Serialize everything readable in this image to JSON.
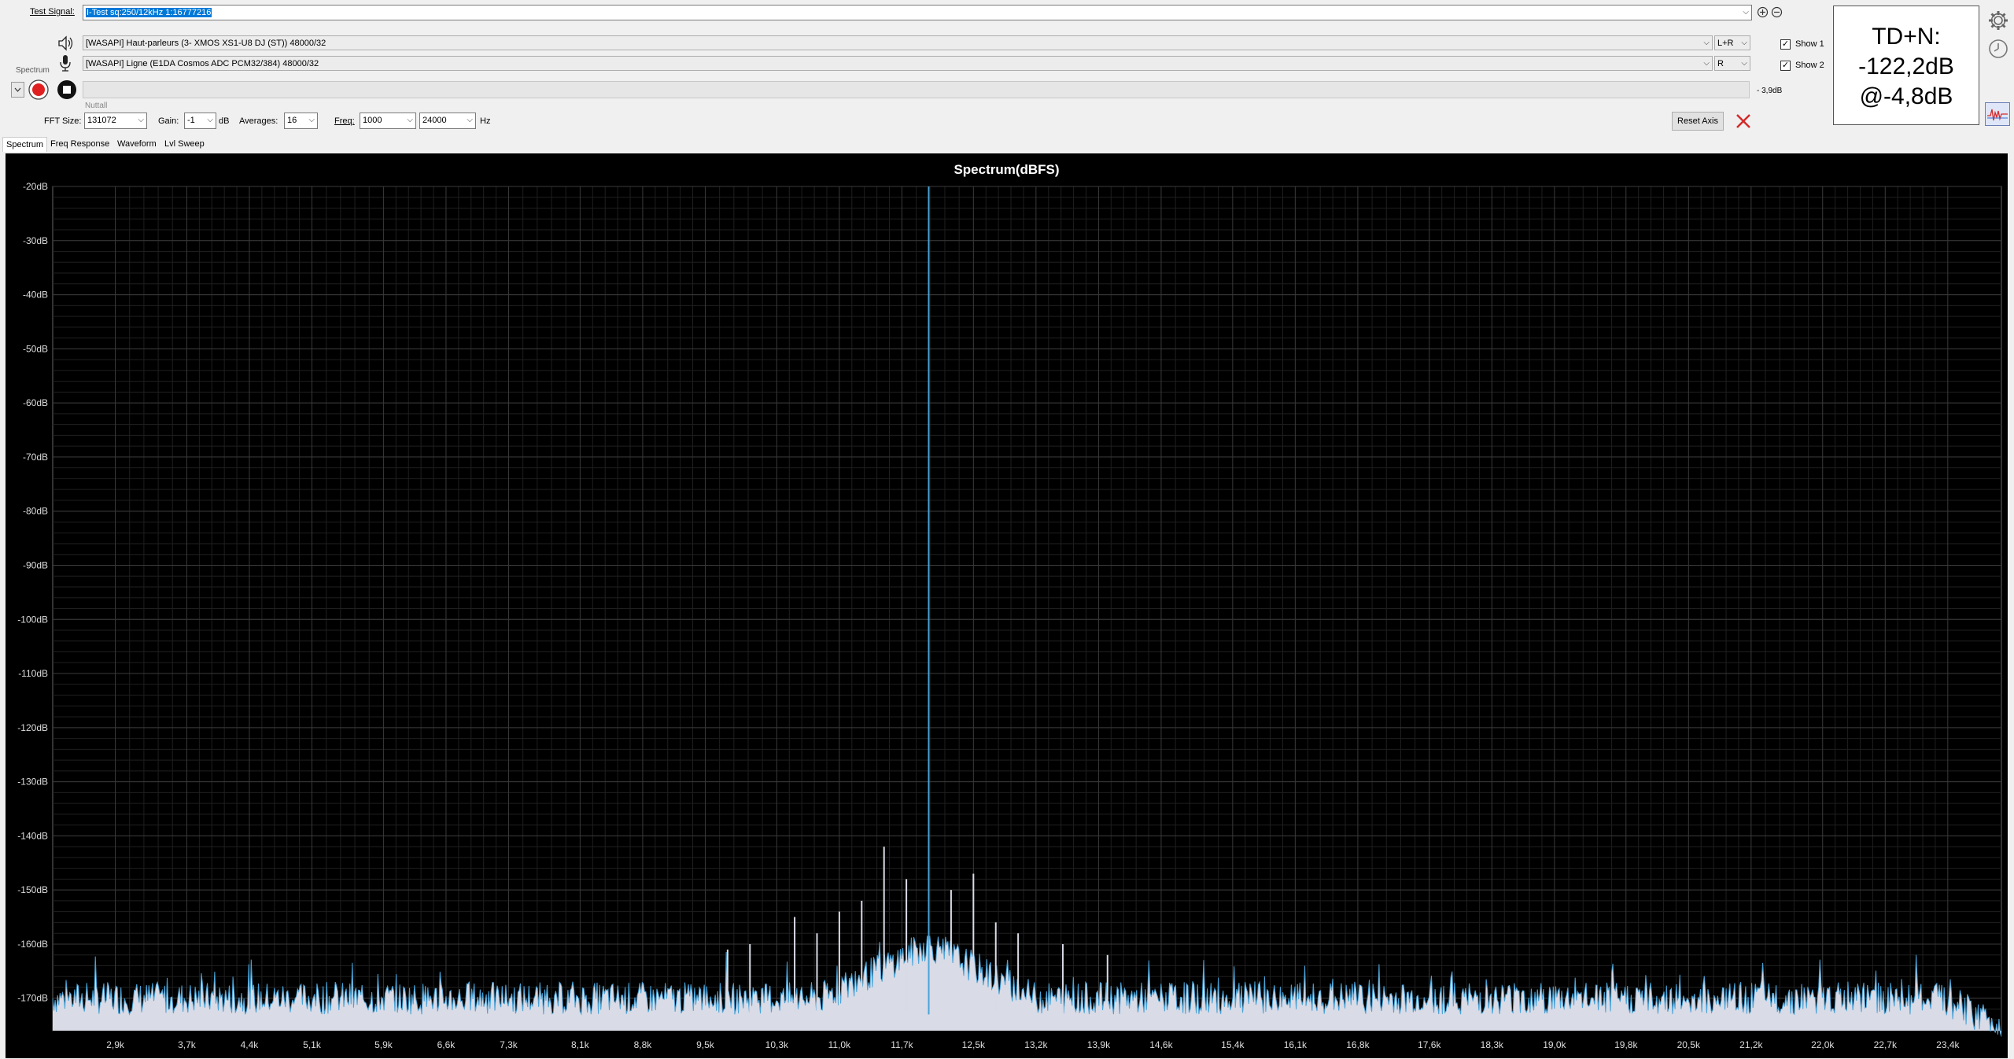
{
  "toolbar": {
    "test_signal_label": "Test Signal:",
    "test_signal_value": "I-Test sq:250/12kHz 1:16777216",
    "spectrum_label": "Spectrum",
    "output_device": "[WASAPI] Haut-parleurs (3- XMOS XS1-U8 DJ (ST)) 48000/32",
    "output_channel": "L+R",
    "input_device": "[WASAPI] Ligne (E1DA Cosmos ADC PCM32/384) 48000/32",
    "input_channel": "R",
    "level_readout": "- 3,9dB",
    "window_name": "Nuttall",
    "show1_label": "Show 1",
    "show2_label": "Show 2",
    "fft_size_label": "FFT Size:",
    "fft_size_value": "131072",
    "gain_label": "Gain:",
    "gain_value": "-1",
    "gain_unit": "dB",
    "averages_label": "Averages:",
    "averages_value": "16",
    "freq_label": "Freq:",
    "freq_value": "1000",
    "freq2_value": "24000",
    "freq_unit": "Hz",
    "reset_axis_label": "Reset Axis"
  },
  "tabs": [
    "Spectrum",
    "Freq Response",
    "Waveform",
    "Lvl Sweep"
  ],
  "readout": {
    "line1": "TD+N:",
    "line2": "-122,2dB",
    "line3": "@-4,8dB"
  },
  "colors": {
    "trace": "#4aa3d8",
    "fill": "#d9dbe6",
    "background": "#000000",
    "grid": "#3a3a3a",
    "close_red": "#d42a2a",
    "record_red": "#e02020"
  },
  "chart_data": {
    "type": "line",
    "title": "Spectrum(dBFS)",
    "ylim": [
      -176,
      -20
    ],
    "y_ticks": [
      "-20dB",
      "-30dB",
      "-40dB",
      "-50dB",
      "-60dB",
      "-70dB",
      "-80dB",
      "-90dB",
      "-100dB",
      "-110dB",
      "-120dB",
      "-130dB",
      "-140dB",
      "-150dB",
      "-160dB",
      "-170dB"
    ],
    "y_tick_values": [
      -20,
      -30,
      -40,
      -50,
      -60,
      -70,
      -80,
      -90,
      -100,
      -110,
      -120,
      -130,
      -140,
      -150,
      -160,
      -170
    ],
    "x_ticks": [
      "2,9k",
      "3,7k",
      "4,4k",
      "5,1k",
      "5,9k",
      "6,6k",
      "7,3k",
      "8,1k",
      "8,8k",
      "9,5k",
      "10,3k",
      "11,0k",
      "11,7k",
      "12,5k",
      "13,2k",
      "13,9k",
      "14,6k",
      "15,4k",
      "16,1k",
      "16,8k",
      "17,6k",
      "18,3k",
      "19,0k",
      "19,8k",
      "20,5k",
      "21,2k",
      "22,0k",
      "22,7k",
      "23,4k"
    ],
    "x_tick_values": [
      2900,
      3700,
      4400,
      5100,
      5900,
      6600,
      7300,
      8100,
      8800,
      9500,
      10300,
      11000,
      11700,
      12500,
      13200,
      13900,
      14600,
      15400,
      16100,
      16800,
      17600,
      18300,
      19000,
      19800,
      20500,
      21200,
      22000,
      22700,
      23400
    ],
    "xlim": [
      2200,
      24000
    ],
    "noise_floor": -170,
    "peaks": [
      {
        "freq": 12000,
        "level": -20
      },
      {
        "freq": 11750,
        "level": -148
      },
      {
        "freq": 12250,
        "level": -150
      },
      {
        "freq": 11500,
        "level": -142
      },
      {
        "freq": 12500,
        "level": -147
      },
      {
        "freq": 11250,
        "level": -152
      },
      {
        "freq": 12750,
        "level": -156
      },
      {
        "freq": 11000,
        "level": -154
      },
      {
        "freq": 13000,
        "level": -158
      },
      {
        "freq": 10750,
        "level": -158
      },
      {
        "freq": 10500,
        "level": -155
      },
      {
        "freq": 13500,
        "level": -160
      },
      {
        "freq": 10000,
        "level": -160
      },
      {
        "freq": 14000,
        "level": -162
      },
      {
        "freq": 9750,
        "level": -161
      }
    ]
  }
}
